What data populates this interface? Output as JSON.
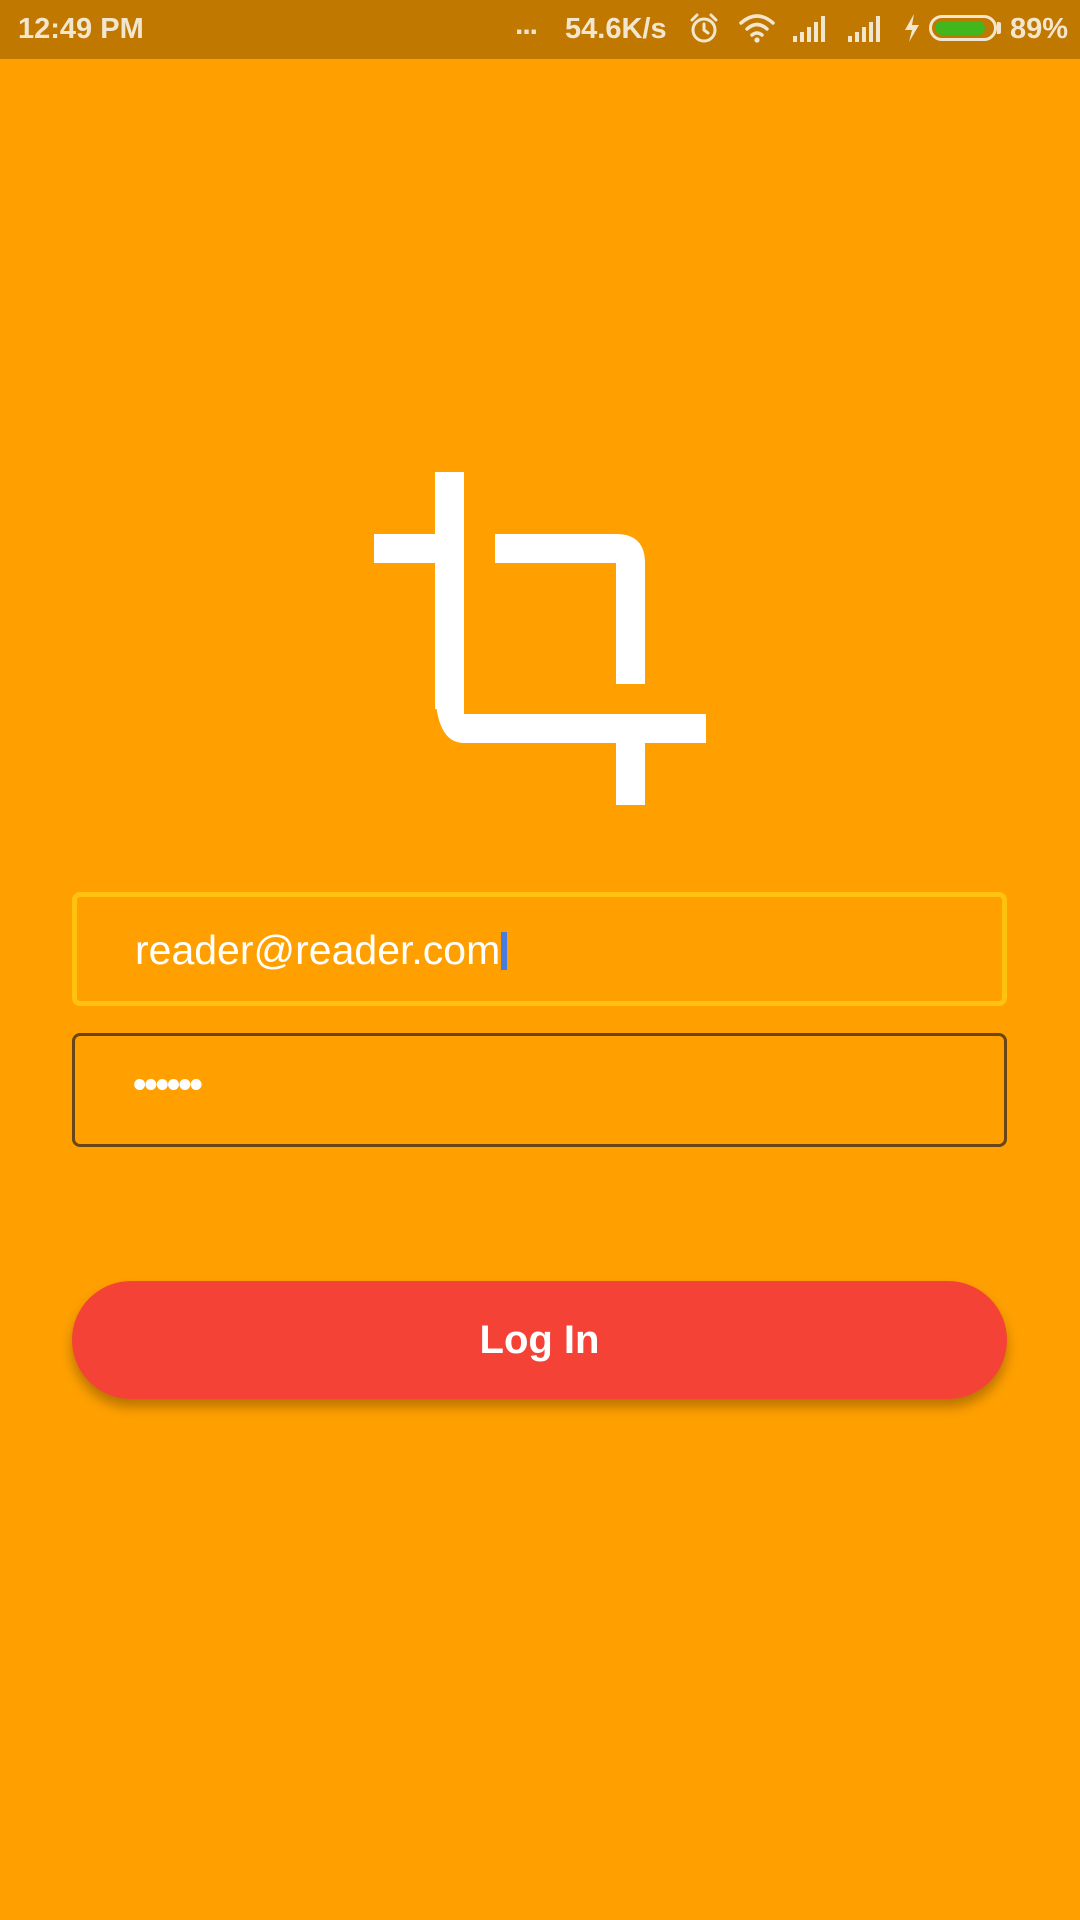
{
  "status_bar": {
    "time": "12:49 PM",
    "dots": "...",
    "network_speed": "54.6K/s",
    "battery_percent": "89%",
    "battery_level": 0.89,
    "battery_color": "#41B61D",
    "icons": [
      "alarm-icon",
      "wifi-icon",
      "signal-icon",
      "signal-icon",
      "charging-icon",
      "battery-icon"
    ]
  },
  "logo": {
    "icon": "crop-icon",
    "color": "#FFFFFF"
  },
  "form": {
    "email_value": "reader@reader.com",
    "password_value": "••••••",
    "login_label": "Log In"
  },
  "colors": {
    "background": "#FFA000",
    "status_bar": "#C17800",
    "button": "#F44336",
    "focused_border": "#FFC20E",
    "field_border": "#6A4616"
  }
}
